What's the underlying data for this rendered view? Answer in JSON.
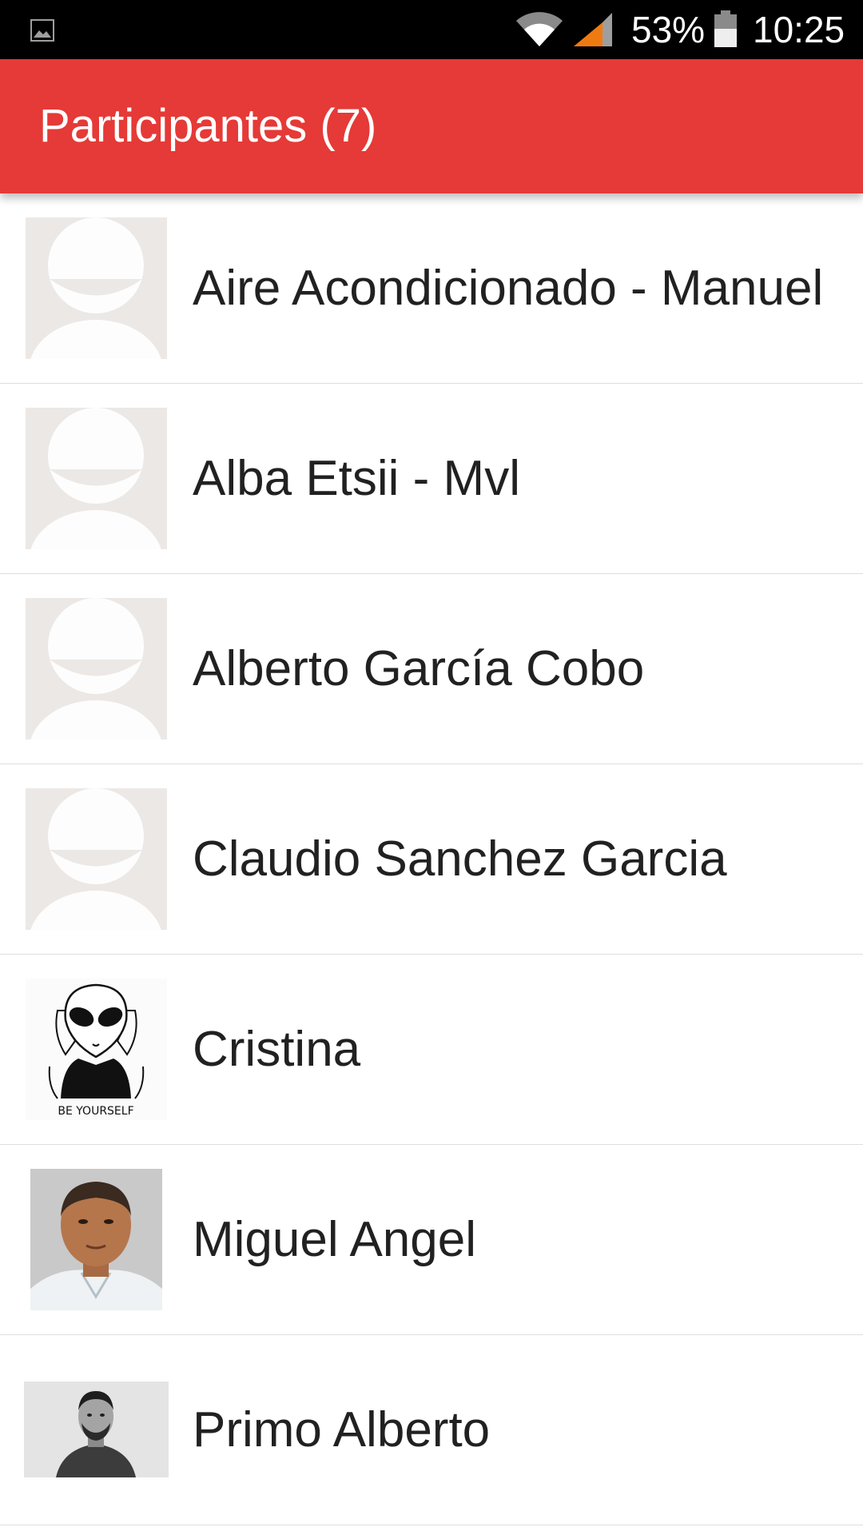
{
  "status_bar": {
    "battery_percent": "53%",
    "time": "10:25",
    "icons": [
      "gallery-icon",
      "wifi-icon",
      "cell-signal-icon",
      "battery-icon"
    ]
  },
  "app_bar": {
    "title": "Participantes (7)",
    "color": "#e53a37"
  },
  "participants": [
    {
      "name": "Aire Acondicionado - Manuel",
      "avatar": "default-avatar"
    },
    {
      "name": "Alba Etsii - Mvl",
      "avatar": "default-avatar"
    },
    {
      "name": "Alberto García Cobo",
      "avatar": "default-avatar"
    },
    {
      "name": "Claudio Sanchez Garcia",
      "avatar": "default-avatar"
    },
    {
      "name": "Cristina",
      "avatar": "alien-illustration",
      "avatar_caption": "BE YOURSELF"
    },
    {
      "name": "Miguel Angel",
      "avatar": "photo"
    },
    {
      "name": "Primo Alberto",
      "avatar": "photo-bw"
    }
  ]
}
